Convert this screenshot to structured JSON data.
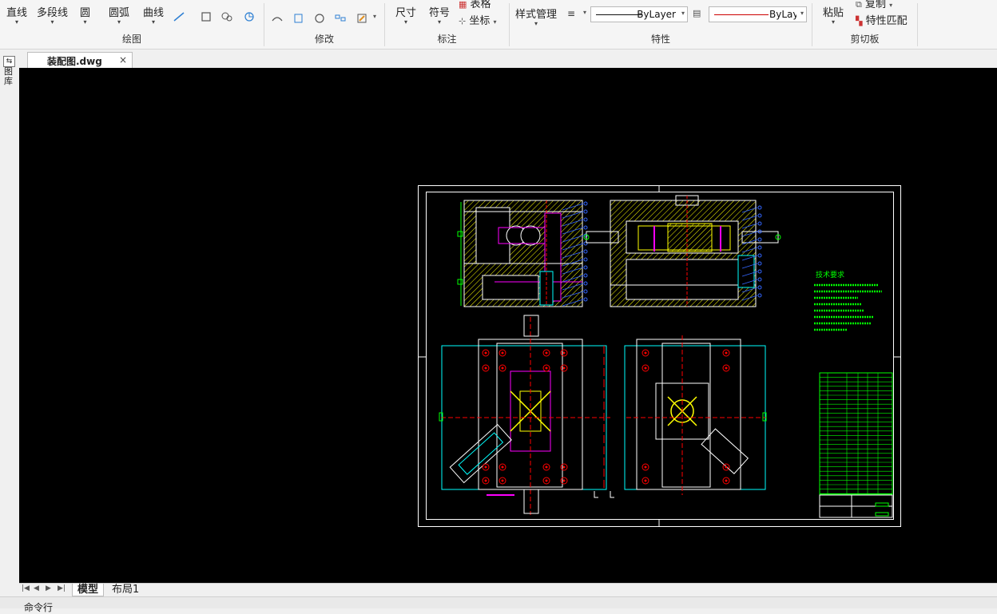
{
  "ribbon": {
    "draw_panel": {
      "title": "绘图",
      "line": "直线",
      "polyline": "多段线",
      "circle": "圆",
      "arc": "圆弧",
      "curve": "曲线"
    },
    "modify_panel": {
      "title": "修改"
    },
    "annotate_panel": {
      "title": "标注",
      "dimension": "尺寸",
      "symbol": "符号",
      "table": "表格",
      "coordinate": "坐标"
    },
    "properties_panel": {
      "title": "特性",
      "style_manager": "样式管理",
      "linetype_value": "ByLayer",
      "color_value": "ByLayer"
    },
    "clipboard_panel": {
      "title": "剪切板",
      "paste": "粘贴",
      "copy": "复制",
      "match_properties": "特性匹配"
    }
  },
  "left_strip": {
    "label": "图库"
  },
  "document": {
    "tab_name": "装配图.dwg",
    "close_glyph": "×"
  },
  "drawing": {
    "tech_req_title": "技术要求"
  },
  "layout_tabs": {
    "items": [
      {
        "label": "模型",
        "active": true
      },
      {
        "label": "布局1",
        "active": false
      }
    ]
  },
  "command_line": {
    "prompt": "命令行"
  },
  "colors": {
    "canvas_bg": "#000000",
    "frame": "#ffffff",
    "hatch": "#ffff00",
    "cyan": "#00ffff",
    "magenta": "#ff00ff",
    "green": "#00ff00",
    "red": "#ff0000",
    "blue_lead": "#3366ff",
    "color_combo_line": "#cc0000"
  }
}
